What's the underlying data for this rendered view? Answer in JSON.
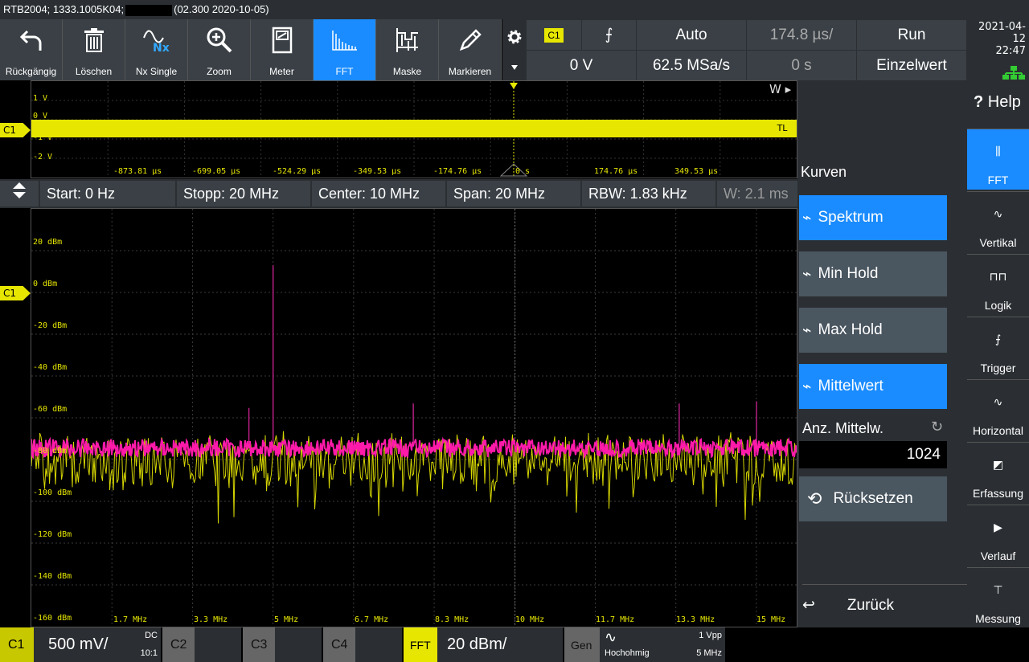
{
  "title": {
    "left": "RTB2004; 1333.1005K04;",
    "right": "(02.300 2020-10-05)"
  },
  "toolbar": [
    {
      "name": "undo",
      "label": "Rückgängig",
      "icon": "undo-icon"
    },
    {
      "name": "delete",
      "label": "Löschen",
      "icon": "trash-icon"
    },
    {
      "name": "nx-single",
      "label": "Nx Single",
      "icon": "nx-single-icon"
    },
    {
      "name": "zoom",
      "label": "Zoom",
      "icon": "zoom-icon"
    },
    {
      "name": "meter",
      "label": "Meter",
      "icon": "meter-icon"
    },
    {
      "name": "fft",
      "label": "FFT",
      "icon": "fft-icon",
      "active": true
    },
    {
      "name": "mask",
      "label": "Maske",
      "icon": "mask-icon"
    },
    {
      "name": "mark",
      "label": "Markieren",
      "icon": "pencil-icon"
    }
  ],
  "trigger": {
    "channel": "C1",
    "slope": "⨍",
    "mode": "Auto",
    "timebase": "174.8 µs/",
    "run": "Run",
    "level": "0 V",
    "samplerate": "62.5 MSa/s",
    "offset": "0 s",
    "single": "Einzelwert"
  },
  "clock": {
    "date": "2021-04-12",
    "time": "22:47"
  },
  "overview": {
    "ylabels": [
      "1 V",
      "0 V",
      "-1 V",
      "-2 V"
    ],
    "xlabels": [
      "-873.81 µs",
      "-699.05 µs",
      "-524.29 µs",
      "-349.53 µs",
      "-174.76 µs",
      "0 s",
      "174.76 µs",
      "349.53 µs"
    ],
    "w": "W ▸",
    "marker": "C1",
    "tl": "TL"
  },
  "fftbar": {
    "start": "Start: 0 Hz",
    "stop": "Stopp: 20 MHz",
    "center": "Center: 10 MHz",
    "span": "Span: 20 MHz",
    "rbw": "RBW: 1.83 kHz",
    "w": "W: 2.1 ms"
  },
  "spectrum": {
    "ylabels": [
      "20 dBm",
      "0 dBm",
      "-20 dBm",
      "-40 dBm",
      "-60 dBm",
      "-80 dBm",
      "-100 dBm",
      "-120 dBm",
      "-140 dBm",
      "-160 dBm"
    ],
    "xlabels": [
      "1.7 MHz",
      "3.3 MHz",
      "5 MHz",
      "6.7 MHz",
      "8.3 MHz",
      "10 MHz",
      "11.7 MHz",
      "13.3 MHz",
      "15 MHz"
    ],
    "marker": "C1"
  },
  "chart_data": {
    "type": "line",
    "x_range_mhz": [
      0,
      15.83
    ],
    "y_range_dbm": [
      -160,
      20
    ],
    "grid": true,
    "series": [],
    "spurs": [
      {
        "x_mhz": 5,
        "y_dbm": 0
      },
      {
        "x_mhz": 4.5,
        "y_dbm": -64
      },
      {
        "x_mhz": 7.9,
        "y_dbm": -62
      },
      {
        "x_mhz": 13.4,
        "y_dbm": -62
      },
      {
        "x_mhz": 15,
        "y_dbm": -61
      }
    ]
  },
  "panel": {
    "heading": "Kurven",
    "buttons": [
      {
        "label": "Spektrum",
        "selected": true
      },
      {
        "label": "Min Hold",
        "selected": false
      },
      {
        "label": "Max Hold",
        "selected": false
      },
      {
        "label": "Mittelwert",
        "selected": true
      }
    ],
    "avg_label": "Anz. Mittelw.",
    "avg_value": "1024",
    "reset": "Rücksetzen",
    "back": "Zurück"
  },
  "right": {
    "help": "Help",
    "items": [
      "FFT",
      "Vertikal",
      "Logik",
      "Trigger",
      "Horizontal",
      "Erfassung",
      "Verlauf",
      "Messung"
    ]
  },
  "bottom": {
    "c1": "C1",
    "c1_scale": "500 mV/",
    "c1_coupling": "DC",
    "c1_probe": "10:1",
    "c2": "C2",
    "c3": "C3",
    "c4": "C4",
    "fft": "FFT",
    "fft_scale": "20 dBm/",
    "gen": "Gen",
    "gen_mode": "Hochohmig",
    "gen_amp": "1 Vpp",
    "gen_freq": "5 MHz"
  }
}
